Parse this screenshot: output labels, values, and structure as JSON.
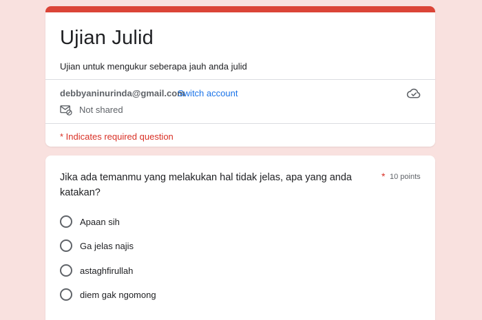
{
  "theme": {
    "accent": "#db4437",
    "background": "#f9e1df",
    "link": "#1a73e8",
    "required": "#d93025"
  },
  "form": {
    "title": "Ujian Julid",
    "description": "Ujian untuk mengukur seberapa jauh anda julid"
  },
  "account": {
    "email": "debbyaninurinda@gmail.com",
    "switch_label": "Switch account",
    "sharing_status": "Not shared",
    "saved_icon": "cloud-done-icon",
    "mail_icon": "mail-not-shared-icon"
  },
  "required_note": "* Indicates required question",
  "question": {
    "text": "Jika ada temanmu yang melakukan hal tidak jelas, apa yang anda katakan?",
    "required_mark": "*",
    "points": "10 points",
    "options": [
      {
        "label": "Apaan sih"
      },
      {
        "label": "Ga jelas najis"
      },
      {
        "label": "astaghfirullah"
      },
      {
        "label": "diem gak ngomong"
      }
    ]
  }
}
